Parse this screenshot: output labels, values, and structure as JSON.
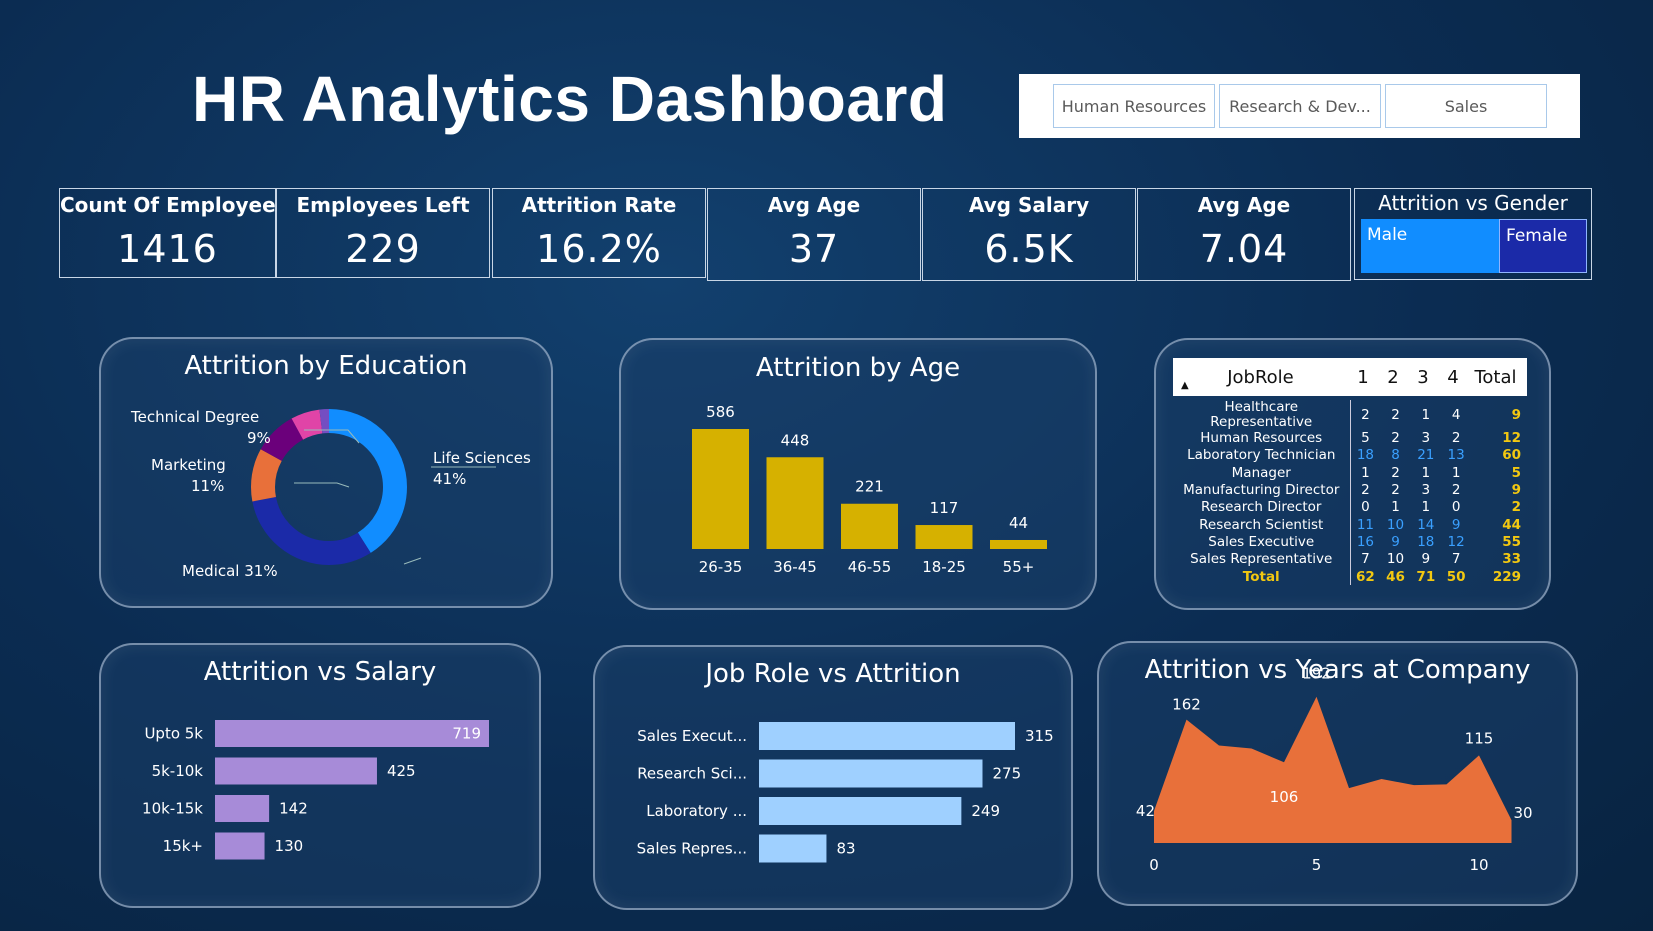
{
  "title": "HR Analytics Dashboard",
  "slicer": {
    "options": [
      "Human Resources",
      "Research & Dev...",
      "Sales"
    ]
  },
  "kpis": [
    {
      "label": "Count Of Employee",
      "value": "1416"
    },
    {
      "label": "Employees Left",
      "value": "229"
    },
    {
      "label": "Attrition Rate",
      "value": "16.2%"
    },
    {
      "label": "Avg Age",
      "value": "37"
    },
    {
      "label": "Avg Salary",
      "value": "6.5K"
    },
    {
      "label": "Avg Age",
      "value": "7.04"
    }
  ],
  "gender": {
    "label": "Attrition vs Gender",
    "male": "Male",
    "female": "Female"
  },
  "colors": {
    "male": "#118dff",
    "female": "#1b2aa8",
    "age_bar": "#d6b100",
    "salary_bar": "#a78bd8",
    "role_bar": "#9fd0ff",
    "years_area": "#e8703a",
    "total_text": "#f2c811",
    "blue_text": "#3aa0ff"
  },
  "chart_data": [
    {
      "type": "pie",
      "title": "Attrition by Education",
      "slices": [
        {
          "name": "Life Sciences",
          "label": "41%",
          "value": 41,
          "color": "#118dff"
        },
        {
          "name": "Medical",
          "label": "31%",
          "value": 31,
          "color": "#1b2aa8"
        },
        {
          "name": "Marketing",
          "label": "11%",
          "value": 11,
          "color": "#e8703a"
        },
        {
          "name": "Technical Degree",
          "label": "9%",
          "value": 9,
          "color": "#6b007b"
        },
        {
          "name": "",
          "label": "",
          "value": 6,
          "color": "#e044a7"
        },
        {
          "name": "",
          "label": "",
          "value": 2,
          "color": "#744ec2"
        }
      ]
    },
    {
      "type": "bar",
      "title": "Attrition by Age",
      "categories": [
        "26-35",
        "36-45",
        "46-55",
        "18-25",
        "55+"
      ],
      "values": [
        586,
        448,
        221,
        117,
        44
      ],
      "ylim": [
        0,
        650
      ]
    },
    {
      "type": "table",
      "title": "JobRole",
      "columns": [
        "JobRole",
        "1",
        "2",
        "3",
        "4",
        "Total"
      ],
      "rows": [
        [
          "Healthcare Representative",
          "2",
          "2",
          "1",
          "4",
          "9"
        ],
        [
          "Human Resources",
          "5",
          "2",
          "3",
          "2",
          "12"
        ],
        [
          "Laboratory Technician",
          "18",
          "8",
          "21",
          "13",
          "60"
        ],
        [
          "Manager",
          "1",
          "2",
          "1",
          "1",
          "5"
        ],
        [
          "Manufacturing Director",
          "2",
          "2",
          "3",
          "2",
          "9"
        ],
        [
          "Research Director",
          "0",
          "1",
          "1",
          "0",
          "2"
        ],
        [
          "Research Scientist",
          "11",
          "10",
          "14",
          "9",
          "44"
        ],
        [
          "Sales Executive",
          "16",
          "9",
          "18",
          "12",
          "55"
        ],
        [
          "Sales Representative",
          "7",
          "10",
          "9",
          "7",
          "33"
        ]
      ],
      "total_row": [
        "Total",
        "62",
        "46",
        "71",
        "50",
        "229"
      ]
    },
    {
      "type": "bar",
      "orientation": "horizontal",
      "title": "Attrition vs Salary",
      "categories": [
        "Upto 5k",
        "5k-10k",
        "10k-15k",
        "15k+"
      ],
      "values": [
        719,
        425,
        142,
        130
      ],
      "xlim": [
        0,
        719
      ]
    },
    {
      "type": "bar",
      "orientation": "horizontal",
      "title": "Job Role vs Attrition",
      "categories": [
        "Sales Execut...",
        "Research Sci...",
        "Laboratory ...",
        "Sales Repres..."
      ],
      "values": [
        315,
        275,
        249,
        83
      ],
      "xlim": [
        0,
        315
      ]
    },
    {
      "type": "area",
      "title": "Attrition vs Years at Company",
      "x": [
        0,
        1,
        2,
        3,
        4,
        5,
        6,
        7,
        8,
        9,
        10,
        11
      ],
      "y": [
        42,
        162,
        128,
        124,
        106,
        192,
        72,
        84,
        76,
        77,
        115,
        30
      ],
      "labels": {
        "0": "42",
        "1": "162",
        "4": "106",
        "5": "192",
        "10": "115",
        "11": "30"
      },
      "xticks": [
        "0",
        "5",
        "10"
      ],
      "ylim": [
        0,
        210
      ]
    }
  ]
}
